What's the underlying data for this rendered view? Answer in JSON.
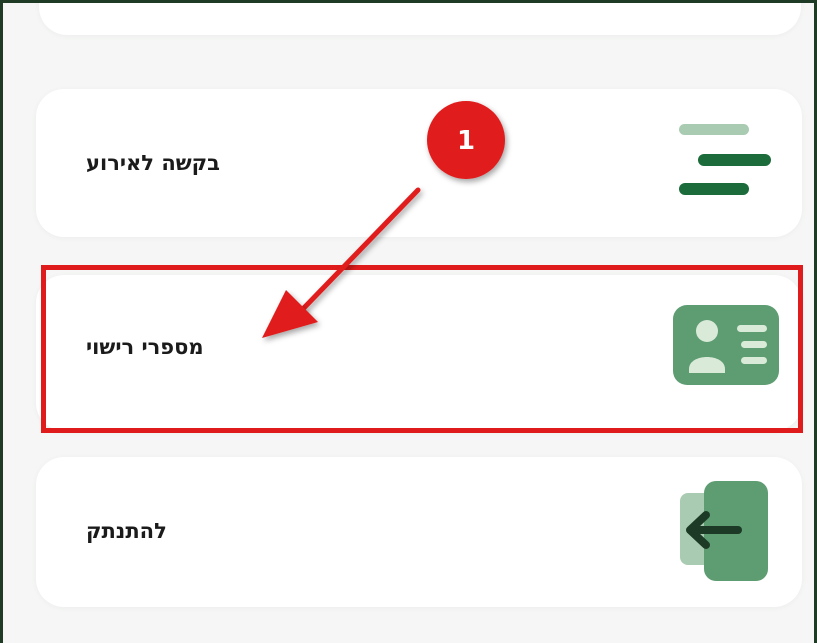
{
  "menu": {
    "items": [
      {
        "label": "בקשה לאירוע",
        "icon": "menu-lines-icon"
      },
      {
        "label": "מספרי רישוי",
        "icon": "id-card-icon"
      },
      {
        "label": "להתנתק",
        "icon": "logout-icon"
      }
    ]
  },
  "annotation": {
    "step_number": "1",
    "color": "#e01b1b"
  },
  "colors": {
    "accent_dark": "#1c6b3a",
    "accent_light": "#a9cbb1",
    "accent_mid": "#5e9c72",
    "frame_border": "#1f3a25",
    "card_bg": "#ffffff",
    "page_bg": "#f5f6f5"
  }
}
